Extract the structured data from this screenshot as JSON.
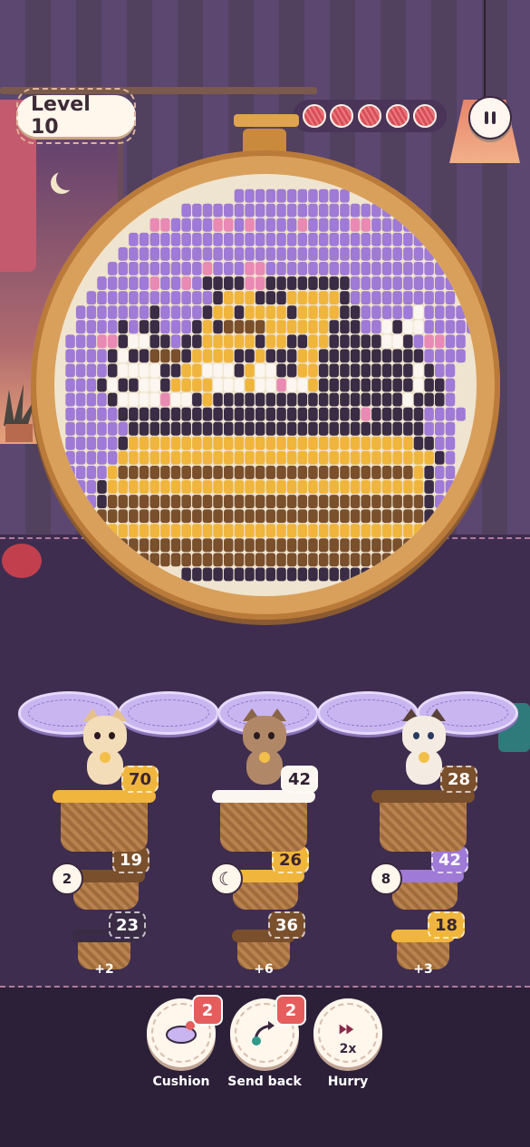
{
  "hud": {
    "level_label": "Level 10",
    "yarn_balls": 5,
    "pause_icon": "pause-icon"
  },
  "colors": {
    "purple": "#9f7ad6",
    "pink": "#e88ab4",
    "gold": "#f0b53c",
    "brown": "#7a4f2c",
    "dark": "#3a2c45",
    "white": "#fbf6ef",
    "empty": "#efe4cf"
  },
  "pattern": [
    "eeeeeeeeeeeeeeeeeeeeeeeeeeeeeeeeeeeeeeee",
    "eeeeeeeeeeeeeeeeepppppppppppeeeeeeeeeeee",
    "eeeeeeeeeeeeppppppppppppppppppppeeeeeeee",
    "eeeeeeeeekkppppkkpkppppkppppkkppppeeeeee",
    "eeeeeeeppppppppppppppppppppppppppppeeeee",
    "eeeeeepppppppppppppppppppppppppppppppeee",
    "eeeeepppppppppkpppkkpppppppppppppppppeee",
    "eeeepppppkppkpddddkkddddddddpppppppppppe",
    "eeeppppppppppppdgggdddgggggdppppppppppee",
    "eepppppppdppppdggdggggdggggddpppppwppppe",
    "eeppppdpddpppdgdbbbbggggggdddppwdwwpppppe",
    "epppkkdwwddpddgggggdggddggdddddwwdpkkppe",
    "eppppdwddbbbdggggddgdddggddddddddddppppe",
    "eppppdwwwwddggwwwdgwwddggdddddddddwdppe",
    "epppdwddwwdggggwwwgwwkwwgdddddddddwddpe",
    "eppppdwwwwkwwdgddddddddddddddddddwdddpe",
    "epppppdddddddddddddddddddddddkdddddppppe",
    "eppppppddddddddddddddddddddddddddddpppe",
    "epppppdgggggggggggggggggggggggggggddppe",
    "epppppggggggggggggggggggggggggggggggdpe",
    "eppppgbbbbbbbbbbbbbbbbbbbbbbbbbbbbgdppe",
    "eeppdggggggggggggggggggggggggggggggdppe",
    "eeppdbbbbbbbbbbbbbbbbbbbbbbbbbbbbbbdpee",
    "eeedbbbbbbbbbbbbbbbbbbbbbbbbbbbbbbbdeee",
    "eeeegggggggggggggggggggggggggggggggdeee",
    "eeeeebbbbbbbbbbbbbbbbbbbbbbbbbbbbbeeeee",
    "eeeeeeebbbbbbbbbbbbbbbbbbbbbbbbbbbeeeee",
    "eeeeeeeeeeeedddddddddddddddddddeeeeeeeee",
    "eeeeeeeeeeeeeeeeeeeeeeeeeeeeeeeeeeeeeeee"
  ],
  "cushions": 5,
  "lanes": [
    {
      "cat_name": "cream-tabby-cat",
      "front_count": "70",
      "front_color": "#f0b53c",
      "front_text": "#3a2530",
      "rim_color": "#f0b53c",
      "second_count": "19",
      "second_color": "#7a4f2c",
      "second_text": "#ffffff",
      "third_count": "23",
      "third_color": "#3a2c45",
      "third_text": "#ffffff",
      "lane_marker": "2",
      "extra_label": "+2"
    },
    {
      "cat_name": "brown-tabby-cat",
      "front_count": "42",
      "front_color": "#fbf6ef",
      "front_text": "#2e2030",
      "rim_color": "#fbf6ef",
      "second_count": "26",
      "second_color": "#f0b53c",
      "second_text": "#3a2530",
      "third_count": "36",
      "third_color": "#7a4f2c",
      "third_text": "#ffffff",
      "lane_marker": "☾",
      "extra_label": "+6"
    },
    {
      "cat_name": "siamese-cat",
      "front_count": "28",
      "front_color": "#7a4f2c",
      "front_text": "#ffffff",
      "rim_color": "#7a4f2c",
      "second_count": "42",
      "second_color": "#9f7ad6",
      "second_text": "#ffffff",
      "third_count": "18",
      "third_color": "#f0b53c",
      "third_text": "#3a2530",
      "lane_marker": "8",
      "extra_label": "+3"
    }
  ],
  "powerups": [
    {
      "label": "Cushion",
      "count": "2",
      "icon": "cushion-icon"
    },
    {
      "label": "Send back",
      "count": "2",
      "icon": "send-back-icon"
    },
    {
      "label": "Hurry",
      "count": "",
      "icon": "fast-forward-icon",
      "icon_text": "2x"
    }
  ]
}
